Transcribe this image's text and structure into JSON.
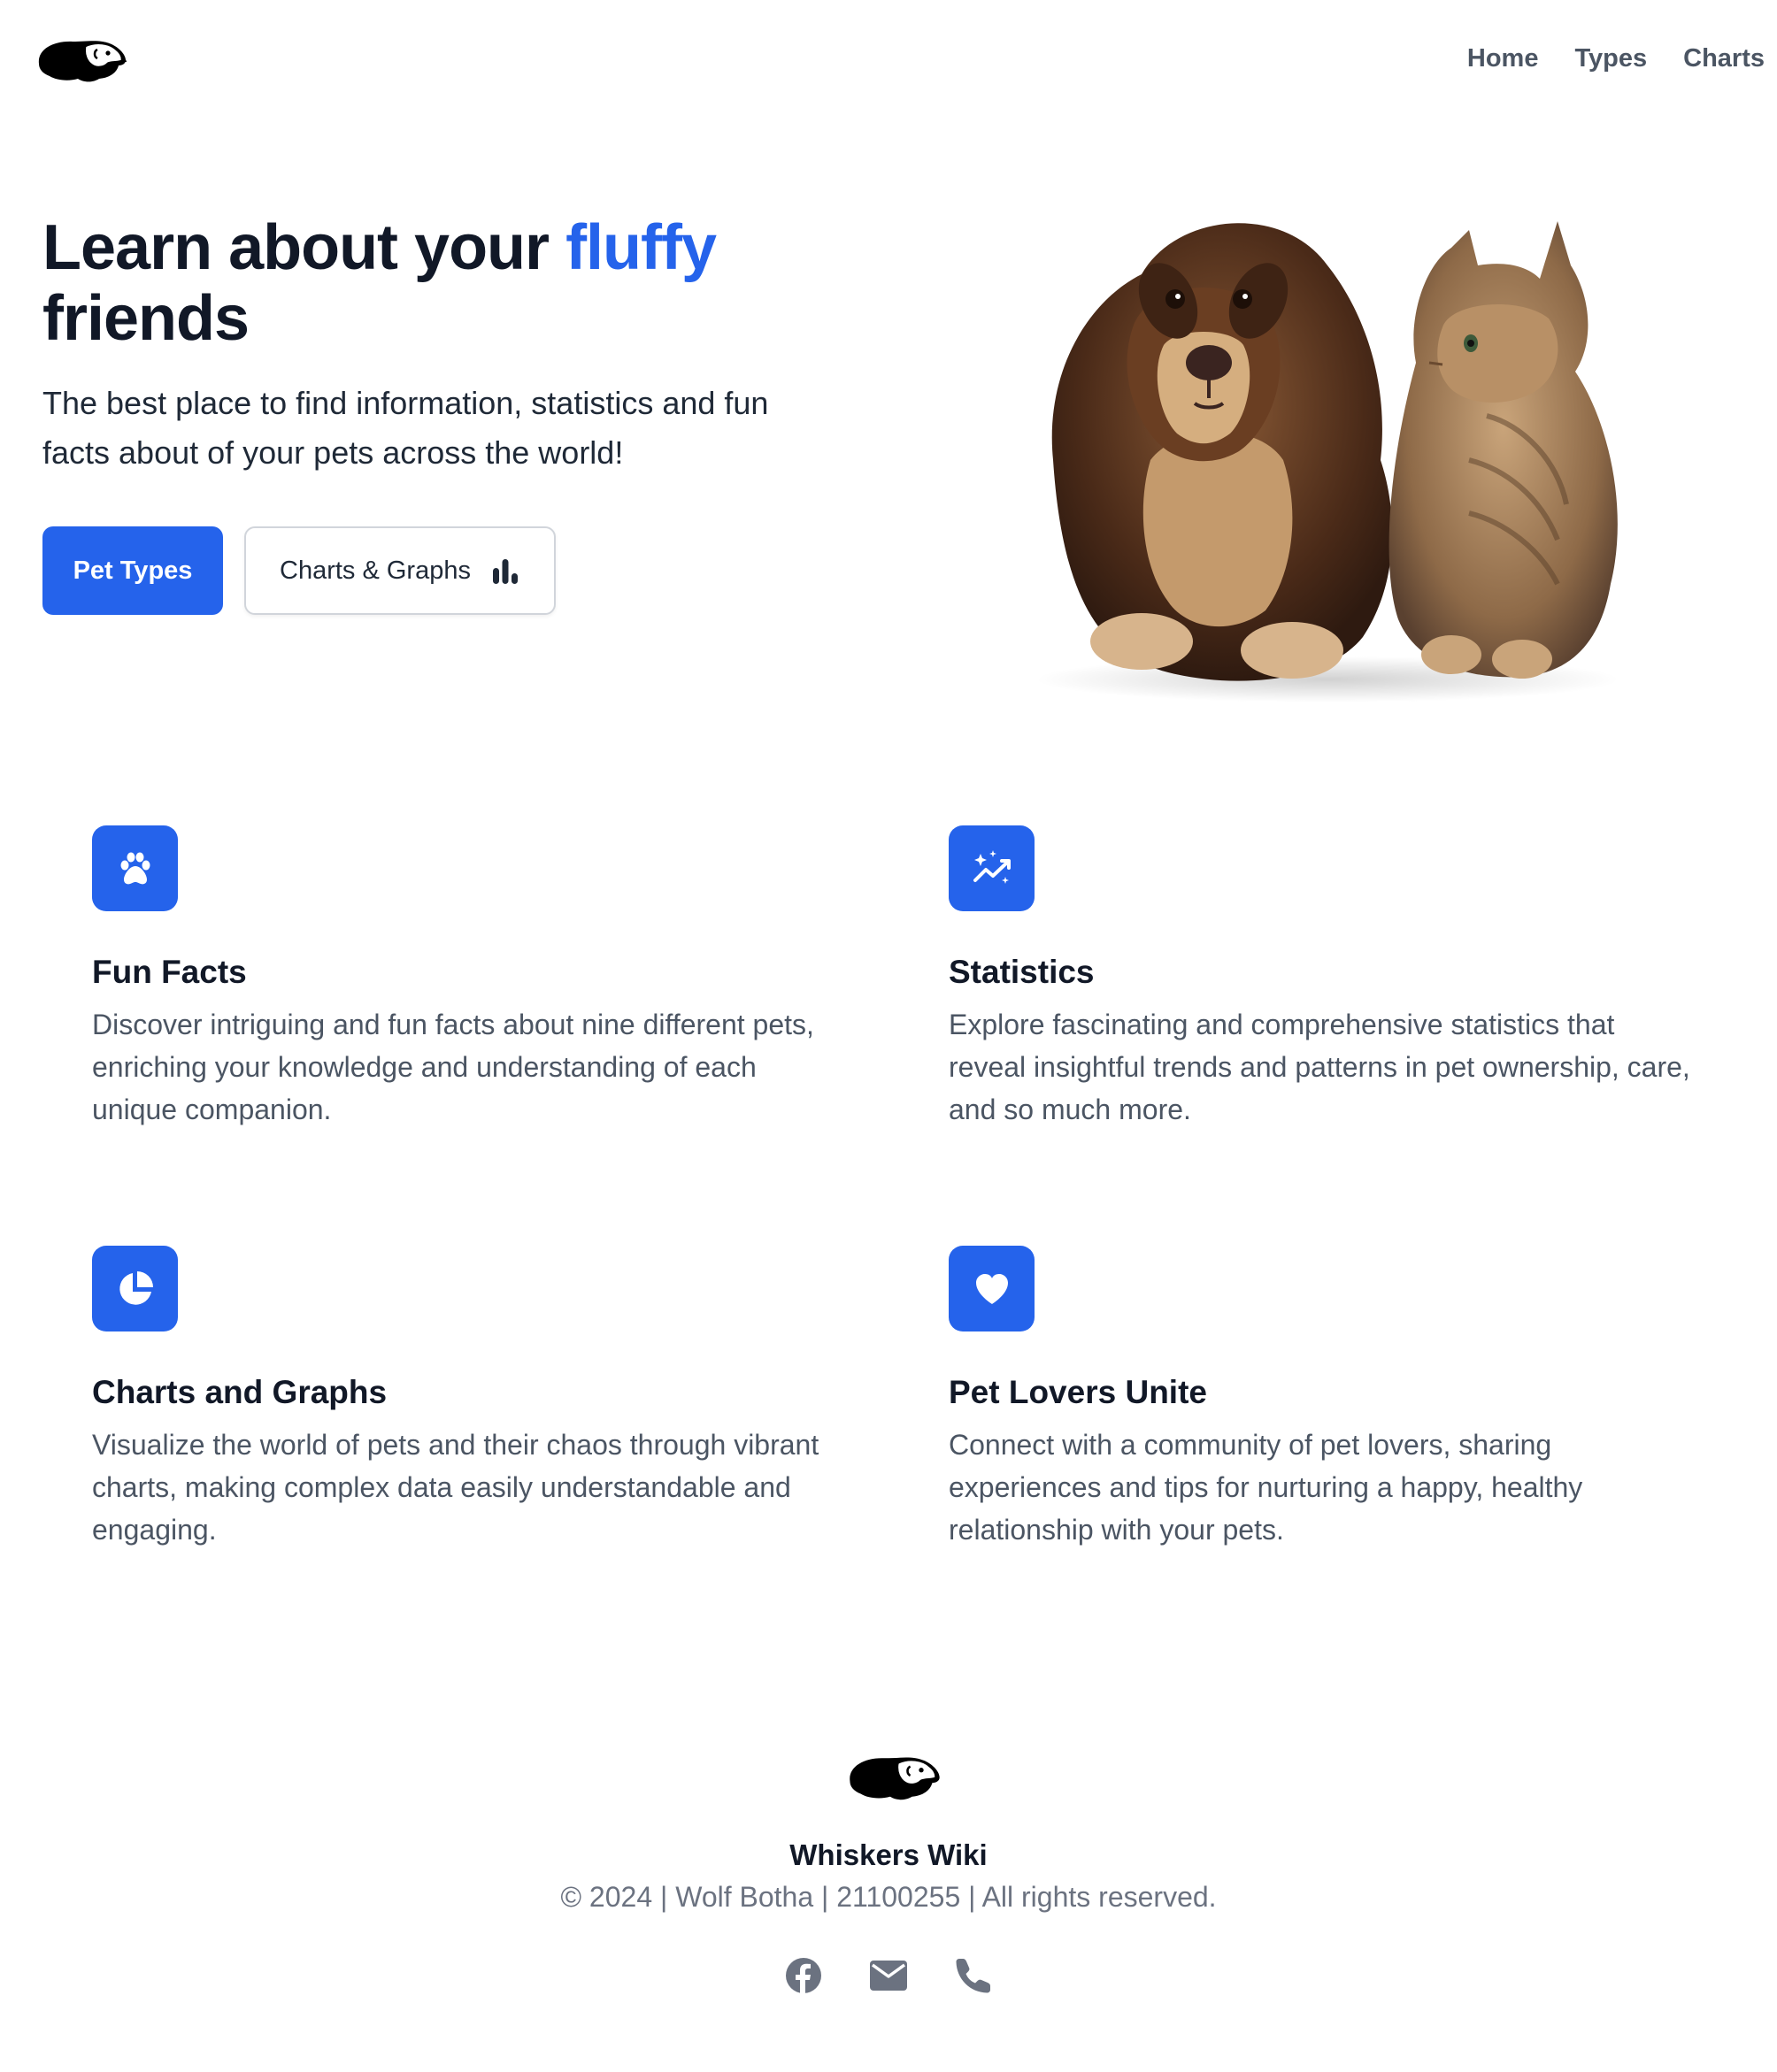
{
  "header": {
    "logo_icon": "guinea-pig-logo",
    "nav": [
      {
        "label": "Home"
      },
      {
        "label": "Types"
      },
      {
        "label": "Charts"
      }
    ]
  },
  "hero": {
    "title_part1": "Learn about your ",
    "title_accent": "fluffy",
    "title_part2": "friends",
    "subtitle": "The best place to find information, statistics and fun facts about of your pets across the world!",
    "primary_button": "Pet Types",
    "secondary_button": "Charts & Graphs",
    "secondary_icon": "bar-chart-icon",
    "image_icon": "dog-and-cat-image"
  },
  "features": [
    {
      "icon": "paw-icon",
      "title": "Fun Facts",
      "text": "Discover intriguing and fun facts about nine different pets, enriching your knowledge and understanding of each unique companion."
    },
    {
      "icon": "sparkle-trend-icon",
      "title": "Statistics",
      "text": "Explore fascinating and comprehensive statistics that reveal insightful trends and patterns in pet ownership, care, and so much more."
    },
    {
      "icon": "pie-chart-icon",
      "title": "Charts and Graphs",
      "text": "Visualize the world of pets and their chaos through vibrant charts, making complex data easily understandable and engaging."
    },
    {
      "icon": "heart-icon",
      "title": "Pet Lovers Unite",
      "text": "Connect with a community of pet lovers, sharing experiences and tips for nurturing a happy, healthy relationship with your pets."
    }
  ],
  "footer": {
    "brand": "Whiskers Wiki",
    "copyright": "© 2024 | Wolf Botha | 21100255 | All rights reserved.",
    "socials": [
      {
        "icon": "facebook-icon"
      },
      {
        "icon": "mail-icon"
      },
      {
        "icon": "phone-icon"
      }
    ]
  },
  "colors": {
    "accent": "#2563eb",
    "text": "#111827",
    "muted": "#4b5563"
  }
}
